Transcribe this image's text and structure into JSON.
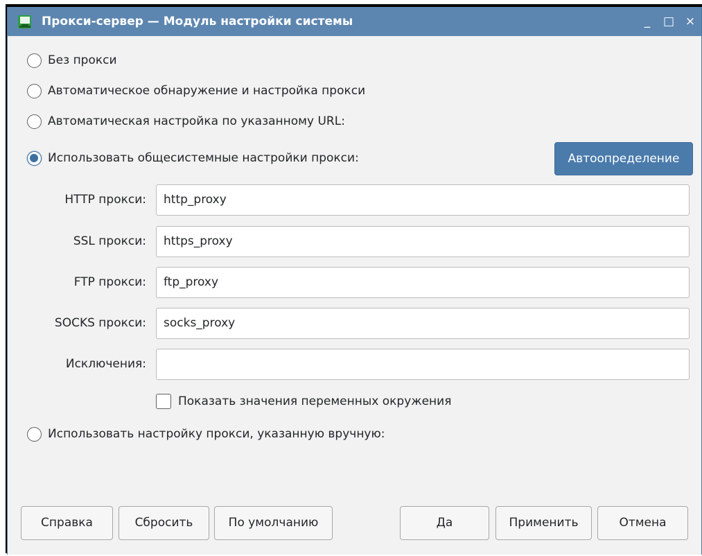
{
  "window": {
    "title": "Прокси-сервер — Модуль настройки системы",
    "icon": "kde-settings-icon",
    "minimize_glyph": "_",
    "maximize_glyph": "□",
    "close_glyph": "×"
  },
  "options": {
    "no_proxy": "Без прокси",
    "auto_detect": "Автоматическое обнаружение и настройка прокси",
    "auto_url": "Автоматическая настройка по указанному URL:",
    "system_settings": "Использовать общесистемные настройки прокси:",
    "manual": "Использовать настройку прокси, указанную вручную:",
    "selected": "system_settings"
  },
  "auto_detect_button": "Автоопределение",
  "fields": {
    "http": {
      "label": "HTTP прокси:",
      "value": "http_proxy"
    },
    "ssl": {
      "label": "SSL прокси:",
      "value": "https_proxy"
    },
    "ftp": {
      "label": "FTP прокси:",
      "value": "ftp_proxy"
    },
    "socks": {
      "label": "SOCKS прокси:",
      "value": "socks_proxy"
    },
    "exceptions": {
      "label": "Исключения:",
      "value": ""
    }
  },
  "show_env_values": {
    "label": "Показать значения переменных окружения",
    "checked": false
  },
  "buttons": {
    "help": "Справка",
    "reset": "Сбросить",
    "defaults": "По умолчанию",
    "ok": "Да",
    "apply": "Применить",
    "cancel": "Отмена"
  },
  "colors": {
    "titlebar": "#5c86b0",
    "accent": "#3e6fa1",
    "primary_button": "#4a7bab"
  }
}
